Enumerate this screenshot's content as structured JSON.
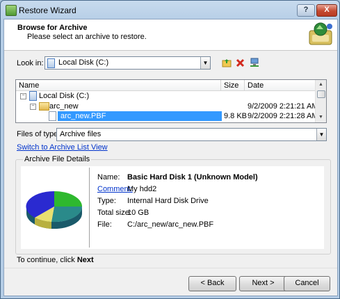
{
  "window": {
    "title": "Restore Wizard",
    "help_label": "?",
    "close_label": "X"
  },
  "header": {
    "title": "Browse for Archive",
    "subtitle": "Please select an archive to restore."
  },
  "look_in": {
    "label": "Look in:",
    "value": "Local Disk (C:)"
  },
  "file_list": {
    "columns": [
      "Name",
      "Size",
      "Date"
    ],
    "rows": [
      {
        "name": "Local Disk (C:)",
        "size": "",
        "date": ""
      },
      {
        "name": "arc_new",
        "size": "",
        "date": "9/2/2009 2:21:21 AM"
      },
      {
        "name": "arc_new.PBF",
        "size": "9.8 KB",
        "date": "9/2/2009 2:21:28 AM"
      }
    ]
  },
  "files_of_type": {
    "label": "Files of type:",
    "value": "Archive files"
  },
  "switch_link": "Switch to Archive List View",
  "details": {
    "group_title": "Archive File Details",
    "name_label": "Name:",
    "name_value": "Basic Hard Disk 1 (Unknown Model)",
    "comment_label": "Comment:",
    "comment_value": "My hdd2",
    "type_label": "Type:",
    "type_value": "Internal Hard Disk Drive",
    "total_size_label": "Total size:",
    "total_size_value": "10 GB",
    "file_label": "File:",
    "file_value": "C:/arc_new/arc_new.PBF"
  },
  "hint": {
    "prefix": "To continue, click ",
    "action": "Next"
  },
  "buttons": {
    "back": "< Back",
    "next": "Next >",
    "cancel": "Cancel"
  },
  "colors": {
    "selection": "#3399ff",
    "link": "#0033cc"
  }
}
